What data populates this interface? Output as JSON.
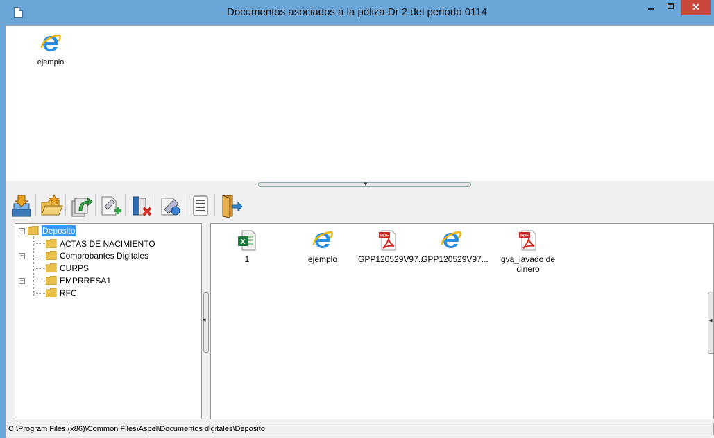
{
  "window": {
    "title": "Documentos asociados a la póliza Dr    2 del periodo 0114",
    "controls": {
      "minimize": "–",
      "maximize": "□",
      "close": "✕"
    }
  },
  "associated": {
    "items": [
      {
        "name": "ejemplo",
        "icon": "ie-icon"
      }
    ]
  },
  "toolbar": {
    "buttons": [
      {
        "name": "copy-to-repository-button",
        "icon": "stack-icon"
      },
      {
        "name": "open-folder-button",
        "icon": "open-folder-icon"
      },
      {
        "name": "associate-button",
        "icon": "green-arrow-icon"
      },
      {
        "name": "add-document-button",
        "icon": "add-doc-icon"
      },
      {
        "name": "delete-document-button",
        "icon": "delete-doc-icon"
      },
      {
        "name": "edit-document-button",
        "icon": "edit-doc-icon"
      },
      {
        "name": "properties-button",
        "icon": "list-icon"
      },
      {
        "name": "exit-button",
        "icon": "exit-door-icon"
      }
    ]
  },
  "tree": {
    "root": "Deposito",
    "children": [
      {
        "label": "ACTAS DE NACIMIENTO",
        "expandable": false
      },
      {
        "label": "Comprobantes Digitales",
        "expandable": true
      },
      {
        "label": "CURPS",
        "expandable": false
      },
      {
        "label": "EMPRRESA1",
        "expandable": true
      },
      {
        "label": "RFC",
        "expandable": false
      }
    ]
  },
  "files": {
    "items": [
      {
        "name": "1",
        "icon": "excel-icon"
      },
      {
        "name": "ejemplo",
        "icon": "ie-icon"
      },
      {
        "name": "GPP120529V97...",
        "icon": "pdf-icon"
      },
      {
        "name": "GPP120529V97...",
        "icon": "ie-icon"
      },
      {
        "name": "gva_lavado de dinero",
        "icon": "pdf-icon"
      }
    ]
  },
  "status": {
    "path": "C:\\Program Files (x86)\\Common Files\\Aspel\\Documentos digitales\\Deposito"
  },
  "colors": {
    "titlebar": "#6aa5d8",
    "close": "#c9483b",
    "selection": "#3399ff",
    "folder": "#e8c04a"
  }
}
